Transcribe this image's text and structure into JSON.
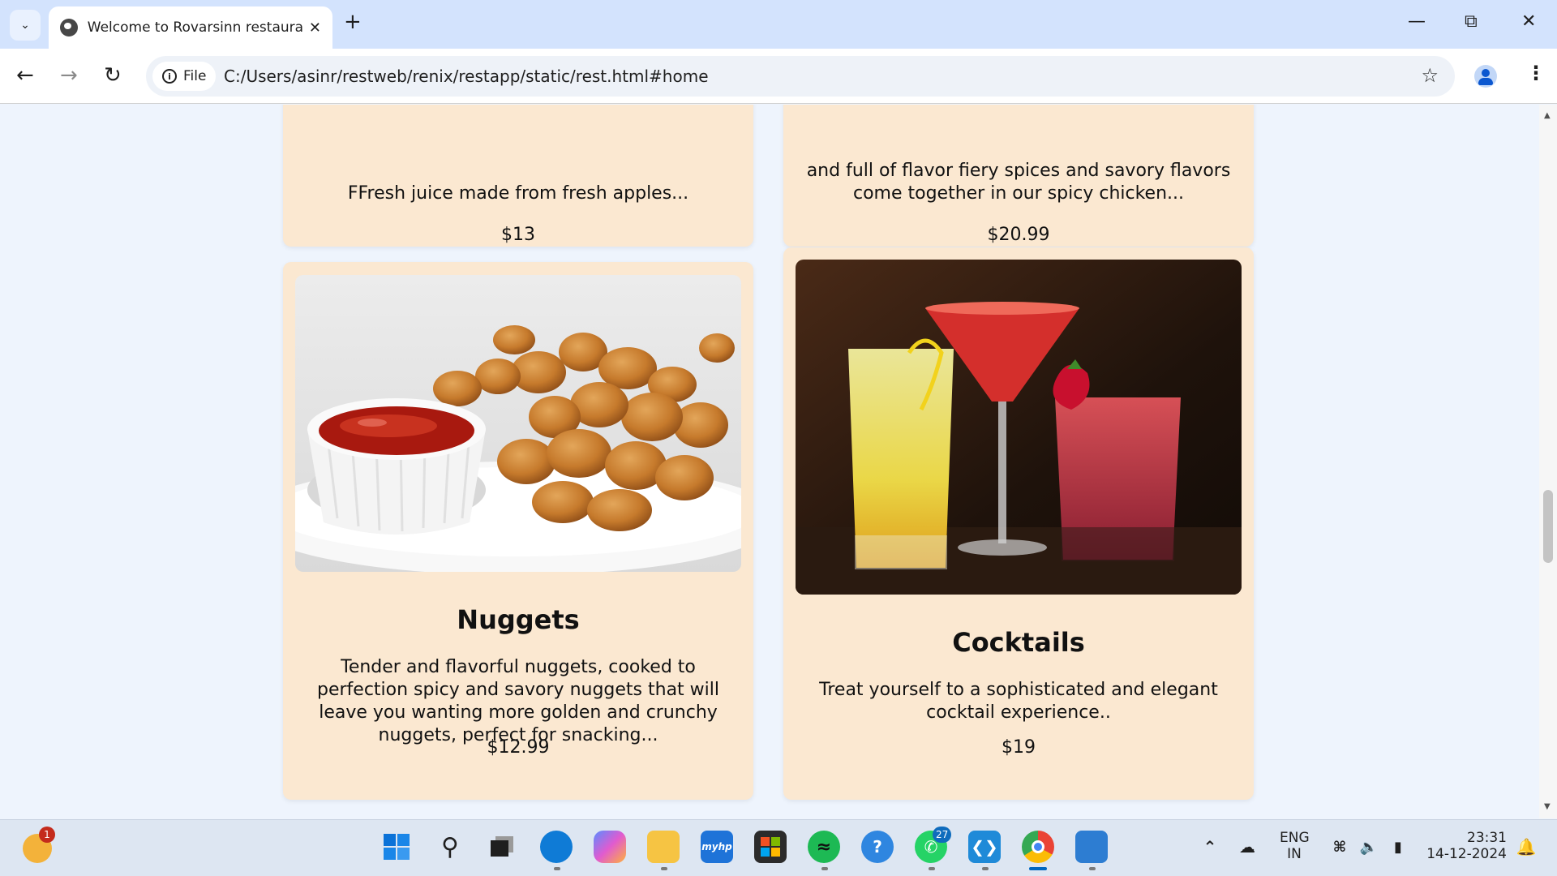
{
  "browser": {
    "tab_title": "Welcome to Rovarsinn restaurant",
    "chip_label": "File",
    "url": "C:/Users/asinr/restweb/renix/restapp/static/rest.html#home"
  },
  "menu_items": {
    "juice": {
      "description": "FFresh juice made from fresh apples...",
      "price": "$13"
    },
    "spicy_chicken": {
      "description": "and full of flavor fiery spices and savory flavors come together in our spicy chicken...",
      "price": "$20.99"
    },
    "nuggets": {
      "title": "Nuggets",
      "description": "Tender and flavorful nuggets, cooked to perfection spicy and savory nuggets that will leave you wanting more golden and crunchy nuggets, perfect for snacking...",
      "price": "$12.99"
    },
    "cocktails": {
      "title": "Cocktails",
      "description": "Treat yourself to a sophisticated and elegant cocktail experience..",
      "price": "$19"
    }
  },
  "taskbar": {
    "weather_badge": "1",
    "whatsapp_badge": "27",
    "hp_label": "myhp",
    "lang_line1": "ENG",
    "lang_line2": "IN",
    "time": "23:31",
    "date": "14-12-2024"
  },
  "colors": {
    "card_bg": "#fbe8d1",
    "page_bg": "#eef4fd",
    "tab_strip": "#d3e3fd"
  }
}
